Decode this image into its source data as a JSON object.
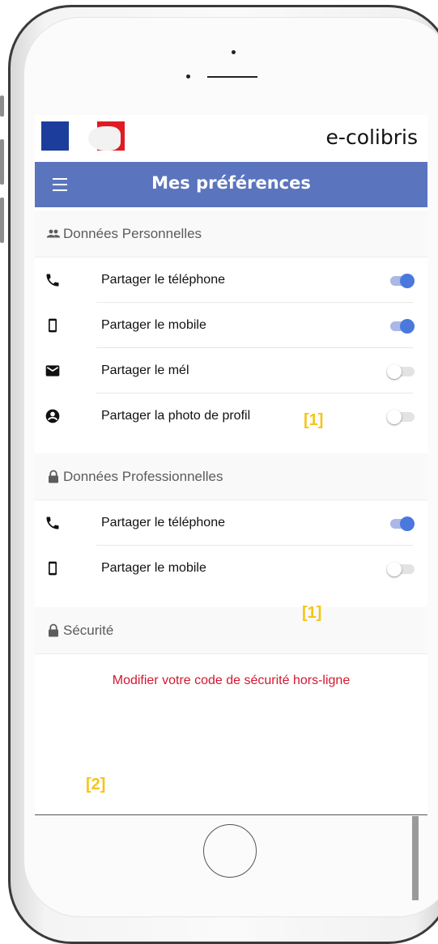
{
  "app": {
    "title": "e-colibris"
  },
  "header": {
    "title": "Mes préférences",
    "menu_icon": "hamburger-icon"
  },
  "sections": {
    "personal": {
      "label": "Données Personnelles",
      "icon": "people-icon",
      "items": [
        {
          "label": "Partager le téléphone",
          "icon": "phone-icon",
          "enabled": true
        },
        {
          "label": "Partager le mobile",
          "icon": "mobile-icon",
          "enabled": true
        },
        {
          "label": "Partager le mél",
          "icon": "mail-icon",
          "enabled": false
        },
        {
          "label": "Partager la photo de profil",
          "icon": "account-circle-icon",
          "enabled": false
        }
      ]
    },
    "professional": {
      "label": "Données Professionnelles",
      "icon": "lock-icon",
      "items": [
        {
          "label": "Partager le téléphone",
          "icon": "phone-icon",
          "enabled": true
        },
        {
          "label": "Partager le mobile",
          "icon": "mobile-icon",
          "enabled": false
        }
      ]
    },
    "security": {
      "label": "Sécurité",
      "icon": "lock-icon",
      "link": "Modifier votre code de sécurité hors-ligne"
    }
  },
  "annotations": {
    "a1": "[1]",
    "a2": "[1]",
    "a3": "[2]"
  },
  "colors": {
    "header_bg": "#5a74bd",
    "toggle_on": "#4a78dc",
    "link_red": "#d3172f",
    "annotation_yellow": "#f5c518",
    "flag_blue": "#1d3d9d",
    "flag_red": "#e01a22"
  }
}
